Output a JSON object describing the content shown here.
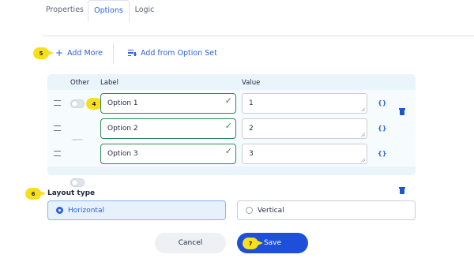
{
  "tabs": [
    {
      "label": "Properties"
    },
    {
      "label": "Options"
    },
    {
      "label": "Logic"
    }
  ],
  "active_tab": "Options",
  "toolbar": {
    "add_more_label": "Add More",
    "add_from_set_label": "Add from Option Set"
  },
  "steps": {
    "add_more": "5",
    "option_label": "4",
    "layout": "6",
    "save": "7"
  },
  "table": {
    "headers": {
      "other": "Other",
      "label": "Label",
      "value": "Value"
    },
    "rows": [
      {
        "label": "Option 1",
        "value": "1",
        "other": false
      },
      {
        "label": "Option 2",
        "value": "2",
        "other": false
      },
      {
        "label": "Option 3",
        "value": "3",
        "other": false
      }
    ]
  },
  "icons": {
    "handle": "drag-handle-icon",
    "code": "code-braces-icon",
    "delete": "trash-icon",
    "valid": "checkmark-icon"
  },
  "layout_type": {
    "title": "Layout type",
    "options": [
      {
        "label": "Horizontal",
        "selected": true
      },
      {
        "label": "Vertical",
        "selected": false
      }
    ]
  },
  "footer": {
    "cancel_label": "Cancel",
    "save_label": "Save"
  },
  "colors": {
    "accent": "#2b63d9",
    "save_button": "#1d4fd8",
    "valid_border": "#2e8b57",
    "badge": "#f8df1c",
    "panel_bg": "#e9f4fb"
  }
}
